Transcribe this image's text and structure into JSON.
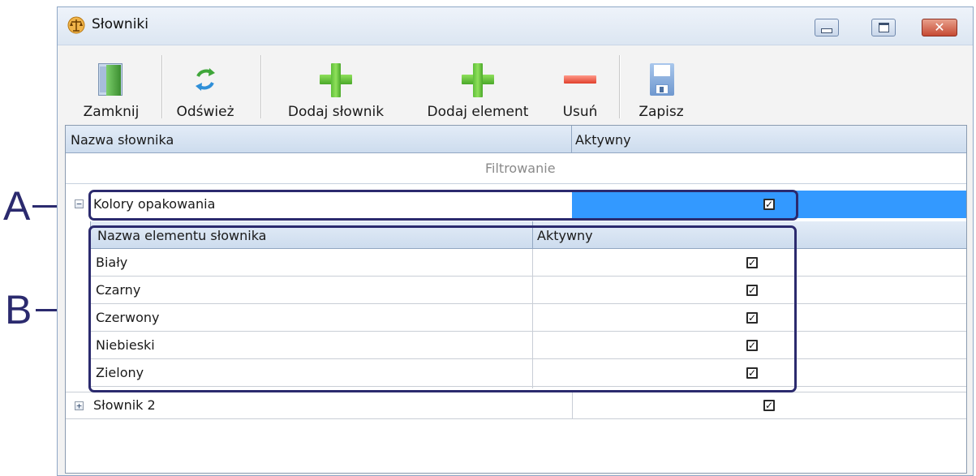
{
  "window": {
    "title": "Słowniki"
  },
  "toolbar": {
    "close": "Zamknij",
    "refresh": "Odśwież",
    "add_dictionary": "Dodaj słownik",
    "add_element": "Dodaj element",
    "remove": "Usuń",
    "save": "Zapisz"
  },
  "grid": {
    "col_name": "Nazwa słownika",
    "col_active": "Aktywny",
    "filter_label": "Filtrowanie",
    "rows": [
      {
        "name": "Kolory opakowania",
        "active": true,
        "expanded": true
      },
      {
        "name": "Słownik 2",
        "active": true,
        "expanded": false
      }
    ]
  },
  "subgrid": {
    "col_name": "Nazwa elementu słownika",
    "col_active": "Aktywny",
    "rows": [
      {
        "name": "Biały",
        "active": true
      },
      {
        "name": "Czarny",
        "active": true
      },
      {
        "name": "Czerwony",
        "active": true
      },
      {
        "name": "Niebieski",
        "active": true
      },
      {
        "name": "Zielony",
        "active": true
      }
    ]
  },
  "callouts": {
    "a": "A",
    "b": "B"
  },
  "icons": {
    "app": "scales-icon",
    "close": "door-exit-icon",
    "refresh": "refresh-arrows-icon",
    "add": "plus-icon",
    "remove": "minus-icon",
    "save": "floppy-disk-icon"
  },
  "colors": {
    "selection": "#3399ff",
    "callout": "#2b2a6e",
    "plus": "#5fbf3a",
    "minus": "#e0402c"
  }
}
